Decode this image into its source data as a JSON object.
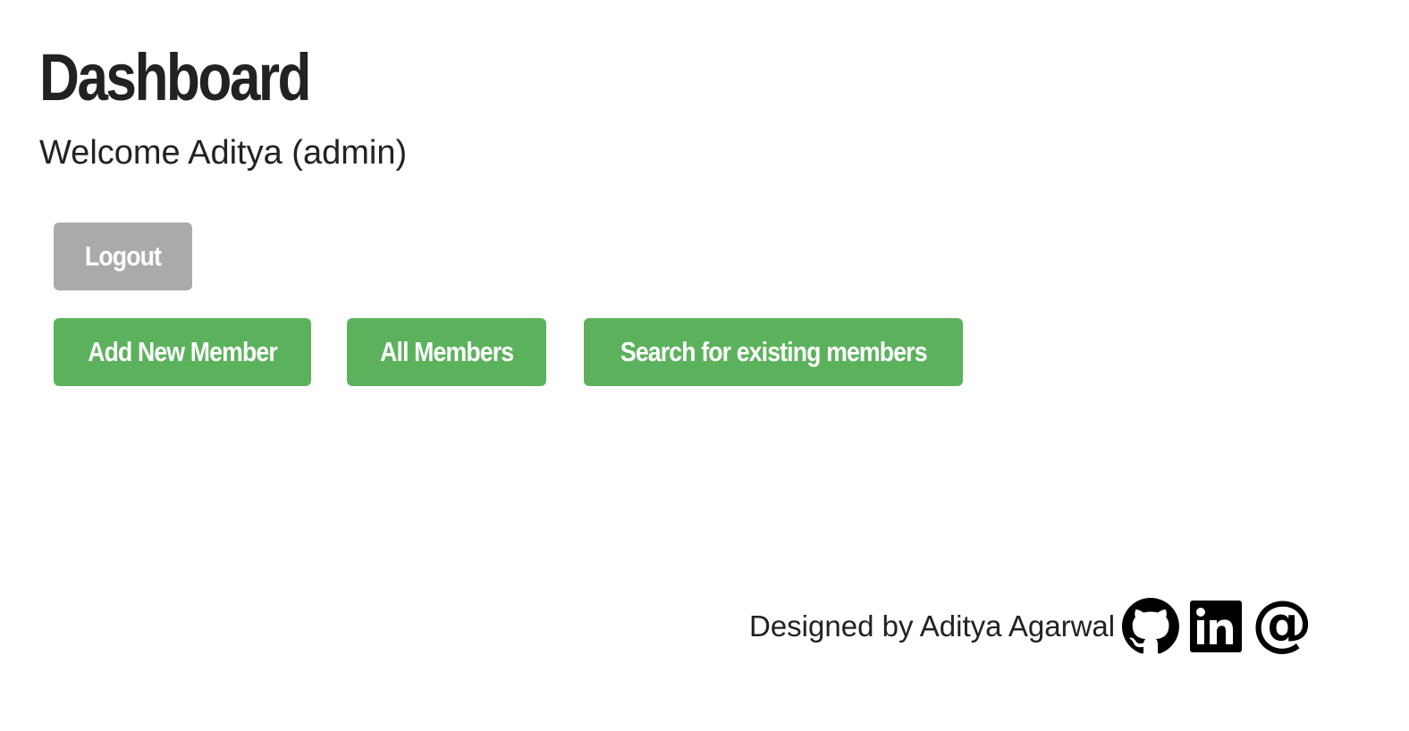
{
  "header": {
    "title": "Dashboard",
    "welcome": "Welcome Aditya (admin)"
  },
  "actions": {
    "logout_label": "Logout",
    "add_member_label": "Add New Member",
    "all_members_label": "All Members",
    "search_members_label": "Search for existing members"
  },
  "footer": {
    "credit": "Designed by Aditya Agarwal",
    "links": [
      {
        "icon": "github-icon"
      },
      {
        "icon": "linkedin-icon"
      },
      {
        "icon": "email-at-icon"
      }
    ]
  },
  "colors": {
    "primary_green": "#5cb25c",
    "logout_gray": "#aaaaaa",
    "text": "#222222"
  }
}
